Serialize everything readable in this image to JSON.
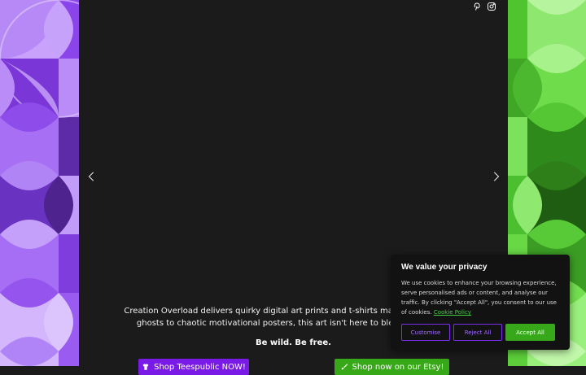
{
  "colors": {
    "purple_accent": "#7a1ae6",
    "green_accent": "#37a817",
    "link_green": "#3fd43f",
    "background": "#1b1b1b"
  },
  "social": {
    "icons": [
      "pinterest-icon",
      "instagram-icon"
    ]
  },
  "slider": {
    "prev_icon": "chevron-left-icon",
    "next_icon": "chevron-right-icon"
  },
  "content": {
    "line1": "Creation Overload delivers quirky digital art prints and t-shirts made for the wild ar",
    "line2": "ghosts to chaotic motivational posters, this art isn't here to blend in. Stand o",
    "tagline": "Be wild. Be free."
  },
  "buttons": {
    "shop_label": "Shop Teespublic NOW!",
    "etsy_label": "Shop now on our Etsy!"
  },
  "cookie": {
    "title": "We value your privacy",
    "text": "We use cookies to enhance your browsing experience, serve personalised ads or content, and analyse our traffic. By clicking \"Accept All\", you consent to our use of cookies.",
    "policy_link": "Cookie Policy",
    "customise": "Customise",
    "reject": "Reject All",
    "accept": "Accept All"
  }
}
